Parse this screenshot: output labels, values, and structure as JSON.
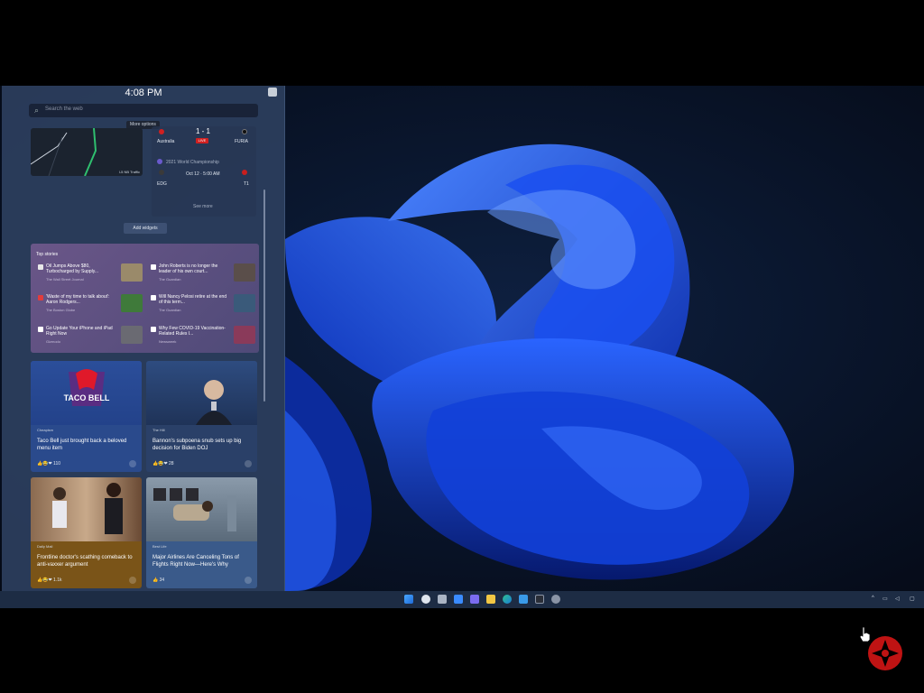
{
  "widgets": {
    "time": "4:08 PM",
    "search_placeholder": "Search the web",
    "tooltip": "More options",
    "add_widgets": "Add widgets",
    "map_caption": "I-5 NB Traffic",
    "sports": {
      "score": "1 - 1",
      "live": "LIVE",
      "team_a": "Australia",
      "team_b": "FURIA",
      "league": "2021 World Championship",
      "match_team_a": "EDG",
      "match_time": "Oct 12 · 5:00 AM",
      "match_team_b": "T1",
      "footer": "See more"
    },
    "top_stories": {
      "header": "Top stories",
      "items": [
        {
          "title": "Oil Jumps Above $80, Turbocharged by Supply...",
          "source": "The Wall Street Journal",
          "thumb_color": "#9a8a6a",
          "icon_color": "#e8e8e8"
        },
        {
          "title": "John Roberts is no longer the leader of his own court...",
          "source": "The Guardian",
          "thumb_color": "#5a4e4a",
          "icon_color": "#ffffff"
        },
        {
          "title": "'Waste of my time to talk about': Aaron Rodgers...",
          "source": "The Boston Globe",
          "thumb_color": "#3f7a3a",
          "icon_color": "#e23c3c"
        },
        {
          "title": "Will Nancy Pelosi retire at the end of this term...",
          "source": "The Guardian",
          "thumb_color": "#3a5a7a",
          "icon_color": "#ffffff"
        },
        {
          "title": "Go Update Your iPhone and iPad Right Now",
          "source": "Gizmodo",
          "thumb_color": "#6a6a72",
          "icon_color": "#ffffff"
        },
        {
          "title": "Why Few COVID-19 Vaccination-Related Rules I...",
          "source": "Newsweek",
          "thumb_color": "#8a3a5a",
          "icon_color": "#ffffff"
        }
      ]
    },
    "cards": [
      {
        "source": "Cheapism",
        "title": "Taco Bell just brought back a beloved menu item",
        "reactions": "👍😂❤ 110",
        "img_caption": "TACO BELL"
      },
      {
        "source": "The Hill",
        "title": "Bannon's subpoena snub sets up big decision for Biden DOJ",
        "reactions": "👍😂❤ 28"
      },
      {
        "source": "Daily Mail",
        "title": "Frontline doctor's scathing comeback to anti-vaxxer argument",
        "reactions": "👍😂❤ 1.1k"
      },
      {
        "source": "Best Life",
        "title": "Major Airlines Are Canceling Tons of Flights Right Now—Here's Why",
        "reactions": "👍 34"
      }
    ]
  },
  "taskbar": {
    "icons": [
      "start-icon",
      "search-icon",
      "task-view-icon",
      "widgets-icon",
      "chat-icon",
      "file-explorer-icon",
      "edge-icon",
      "store-icon",
      "terminal-icon",
      "settings-icon"
    ],
    "tray": [
      "chevron-up-icon",
      "network-icon",
      "volume-icon",
      "notification-icon"
    ]
  },
  "colors": {
    "accent": "#1f5bff",
    "panel": "#2c3e5e",
    "stories": "#5a4e80"
  }
}
